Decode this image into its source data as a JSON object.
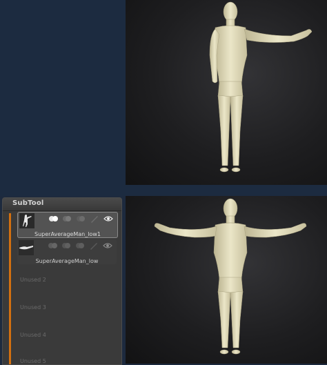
{
  "subtool": {
    "title": "SubTool",
    "items": [
      {
        "label": "SuperAverageMan_low1"
      },
      {
        "label": "SuperAverageMan_low"
      }
    ],
    "unused_slots": [
      "Unused 2",
      "Unused 3",
      "Unused 4",
      "Unused 5"
    ]
  },
  "colors": {
    "scroll_accent": "#d4700f",
    "model_skin": "#e3ddbd",
    "background_blue": "#1c2b40"
  }
}
